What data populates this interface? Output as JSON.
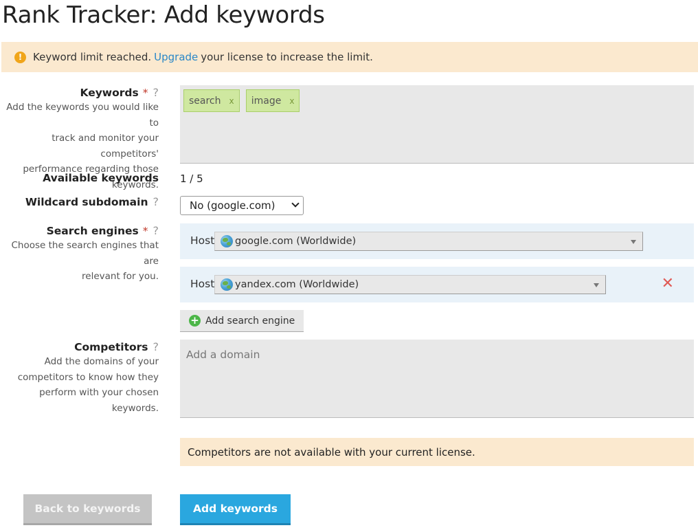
{
  "page": {
    "title": "Rank Tracker: Add keywords"
  },
  "alert": {
    "icon": "warning-icon",
    "before": "Keyword limit reached.",
    "link": "Upgrade",
    "after": "your license to increase the limit."
  },
  "keywords": {
    "label": "Keywords",
    "required_mark": "*",
    "help_mark": "?",
    "description": [
      "Add the keywords you would like to",
      "track and monitor your competitors'",
      "performance regarding those",
      "keywords."
    ],
    "tags": [
      {
        "text": "search",
        "remove": "x"
      },
      {
        "text": "image",
        "remove": "x"
      }
    ]
  },
  "available": {
    "label": "Available keywords",
    "value": "1 / 5"
  },
  "wildcard": {
    "label": "Wildcard subdomain",
    "help_mark": "?",
    "selected": "No (google.com)"
  },
  "search_engines": {
    "label": "Search engines",
    "required_mark": "*",
    "help_mark": "?",
    "description": [
      "Choose the search engines that are",
      "relevant for you."
    ],
    "host_label": "Host",
    "rows": [
      {
        "value": "google.com (Worldwide)",
        "icon": "globe-icon",
        "removable": false
      },
      {
        "value": "yandex.com (Worldwide)",
        "icon": "globe-icon",
        "removable": true,
        "remove_glyph": "✕"
      }
    ],
    "add_button": "Add search engine"
  },
  "competitors": {
    "label": "Competitors",
    "help_mark": "?",
    "description": [
      "Add the domains of your",
      "competitors to know how they",
      "perform with your chosen",
      "keywords."
    ],
    "placeholder": "Add a domain",
    "notice": "Competitors are not available with your current license."
  },
  "actions": {
    "back": "Back to keywords",
    "submit": "Add keywords"
  },
  "colors": {
    "accent": "#2aa7df",
    "warning_bg": "#fbe9cf",
    "tag_bg": "#cfe8a0",
    "remove": "#e05a55"
  }
}
